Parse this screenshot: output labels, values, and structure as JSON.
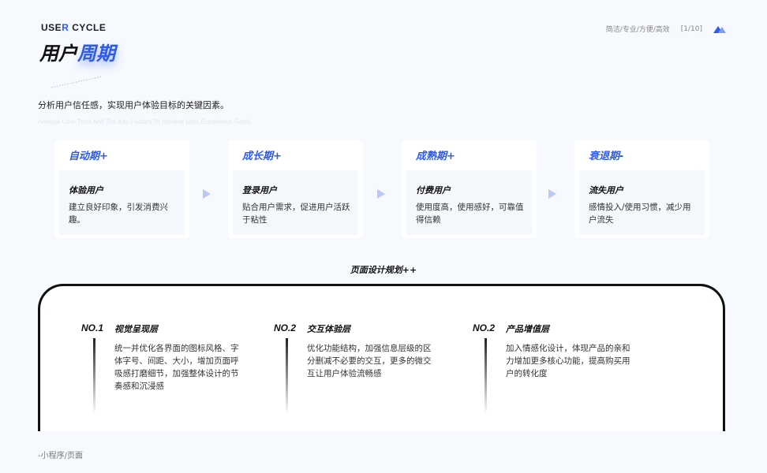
{
  "brand": {
    "prefix": "USE",
    "accent": "R",
    "suffix": " CYCLE"
  },
  "title": {
    "main": "用户",
    "accent": "周期"
  },
  "header": {
    "tags": "简洁/专业/方便/高效",
    "page": "[1/10]",
    "icon": "triangles-icon",
    "accent_color": "#2f5bea"
  },
  "subtitle": {
    "cn": "分析用户信任感，实现用户体验目标的关键因素。",
    "en": "Analyze User Trust And The Key Factors To Achieve User Experience Goals."
  },
  "cycle": [
    {
      "phase": "自动期+",
      "name": "体验用户",
      "desc": "建立良好印象，引发消费兴趣。"
    },
    {
      "phase": "成长期+",
      "name": "登录用户",
      "desc": "贴合用户需求，促进用户活跃于粘性"
    },
    {
      "phase": "成熟期+",
      "name": "付费用户",
      "desc": "使用度高，使用感好，可靠值得信赖"
    },
    {
      "phase": "衰退期-",
      "name": "流失用户",
      "desc": "感情投入/使用习惯，减少用户流失"
    }
  ],
  "plan": {
    "title": "页面设计规划++",
    "items": [
      {
        "no": "NO.1",
        "name": "视觉呈现层",
        "desc": "统一并优化各界面的图标风格、字体字号、间距、大小，增加页面呼吸感打磨细节，加强整体设计的节奏感和沉浸感"
      },
      {
        "no": "NO.2",
        "name": "交互体验层",
        "desc": "优化功能结构，加强信息层级的区分删减不必要的交互，更多的微交互让用户体验流畅感"
      },
      {
        "no": "NO.2",
        "name": "产品增值层",
        "desc": "加入情感化设计，体现产品的亲和力增加更多核心功能，提高购买用户的转化度"
      }
    ]
  },
  "footer": "-小程序/页面"
}
